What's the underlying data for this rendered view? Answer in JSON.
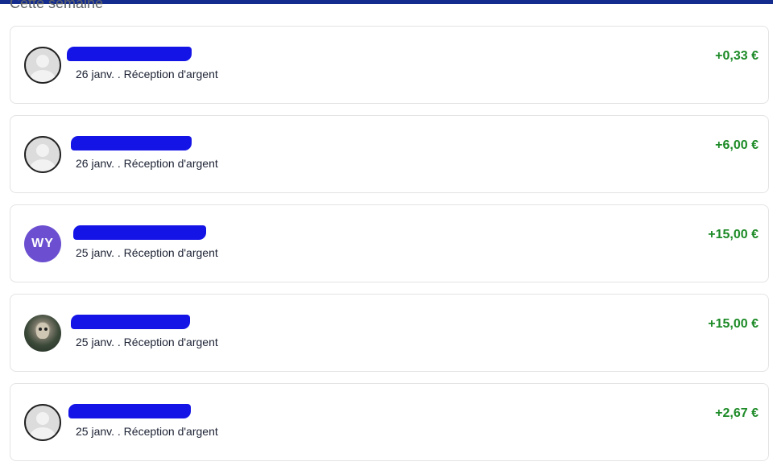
{
  "section": {
    "title": "Cette semaine"
  },
  "colors": {
    "top_bar": "#142c8e",
    "amount_positive": "#1c8a26",
    "redaction": "#1414e6",
    "initials_avatar": "#6b4fd0"
  },
  "transactions": [
    {
      "avatar_type": "placeholder-icon",
      "name_redacted": true,
      "date": "26 janv.",
      "separator": " . ",
      "type": "Réception d'argent",
      "amount": "+0,33 €"
    },
    {
      "avatar_type": "placeholder-icon",
      "name_redacted": true,
      "date": "26 janv.",
      "separator": " . ",
      "type": "Réception d'argent",
      "amount": "+6,00 €"
    },
    {
      "avatar_type": "initials",
      "avatar_initials": "WY",
      "name_redacted": true,
      "date": "25 janv.",
      "separator": " . ",
      "type": "Réception d'argent",
      "amount": "+15,00 €"
    },
    {
      "avatar_type": "photo",
      "name_redacted": true,
      "date": "25 janv.",
      "separator": " . ",
      "type": "Réception d'argent",
      "amount": "+15,00 €"
    },
    {
      "avatar_type": "placeholder-icon",
      "name_redacted": true,
      "date": "25 janv.",
      "separator": " . ",
      "type": "Réception d'argent",
      "amount": "+2,67 €"
    }
  ]
}
